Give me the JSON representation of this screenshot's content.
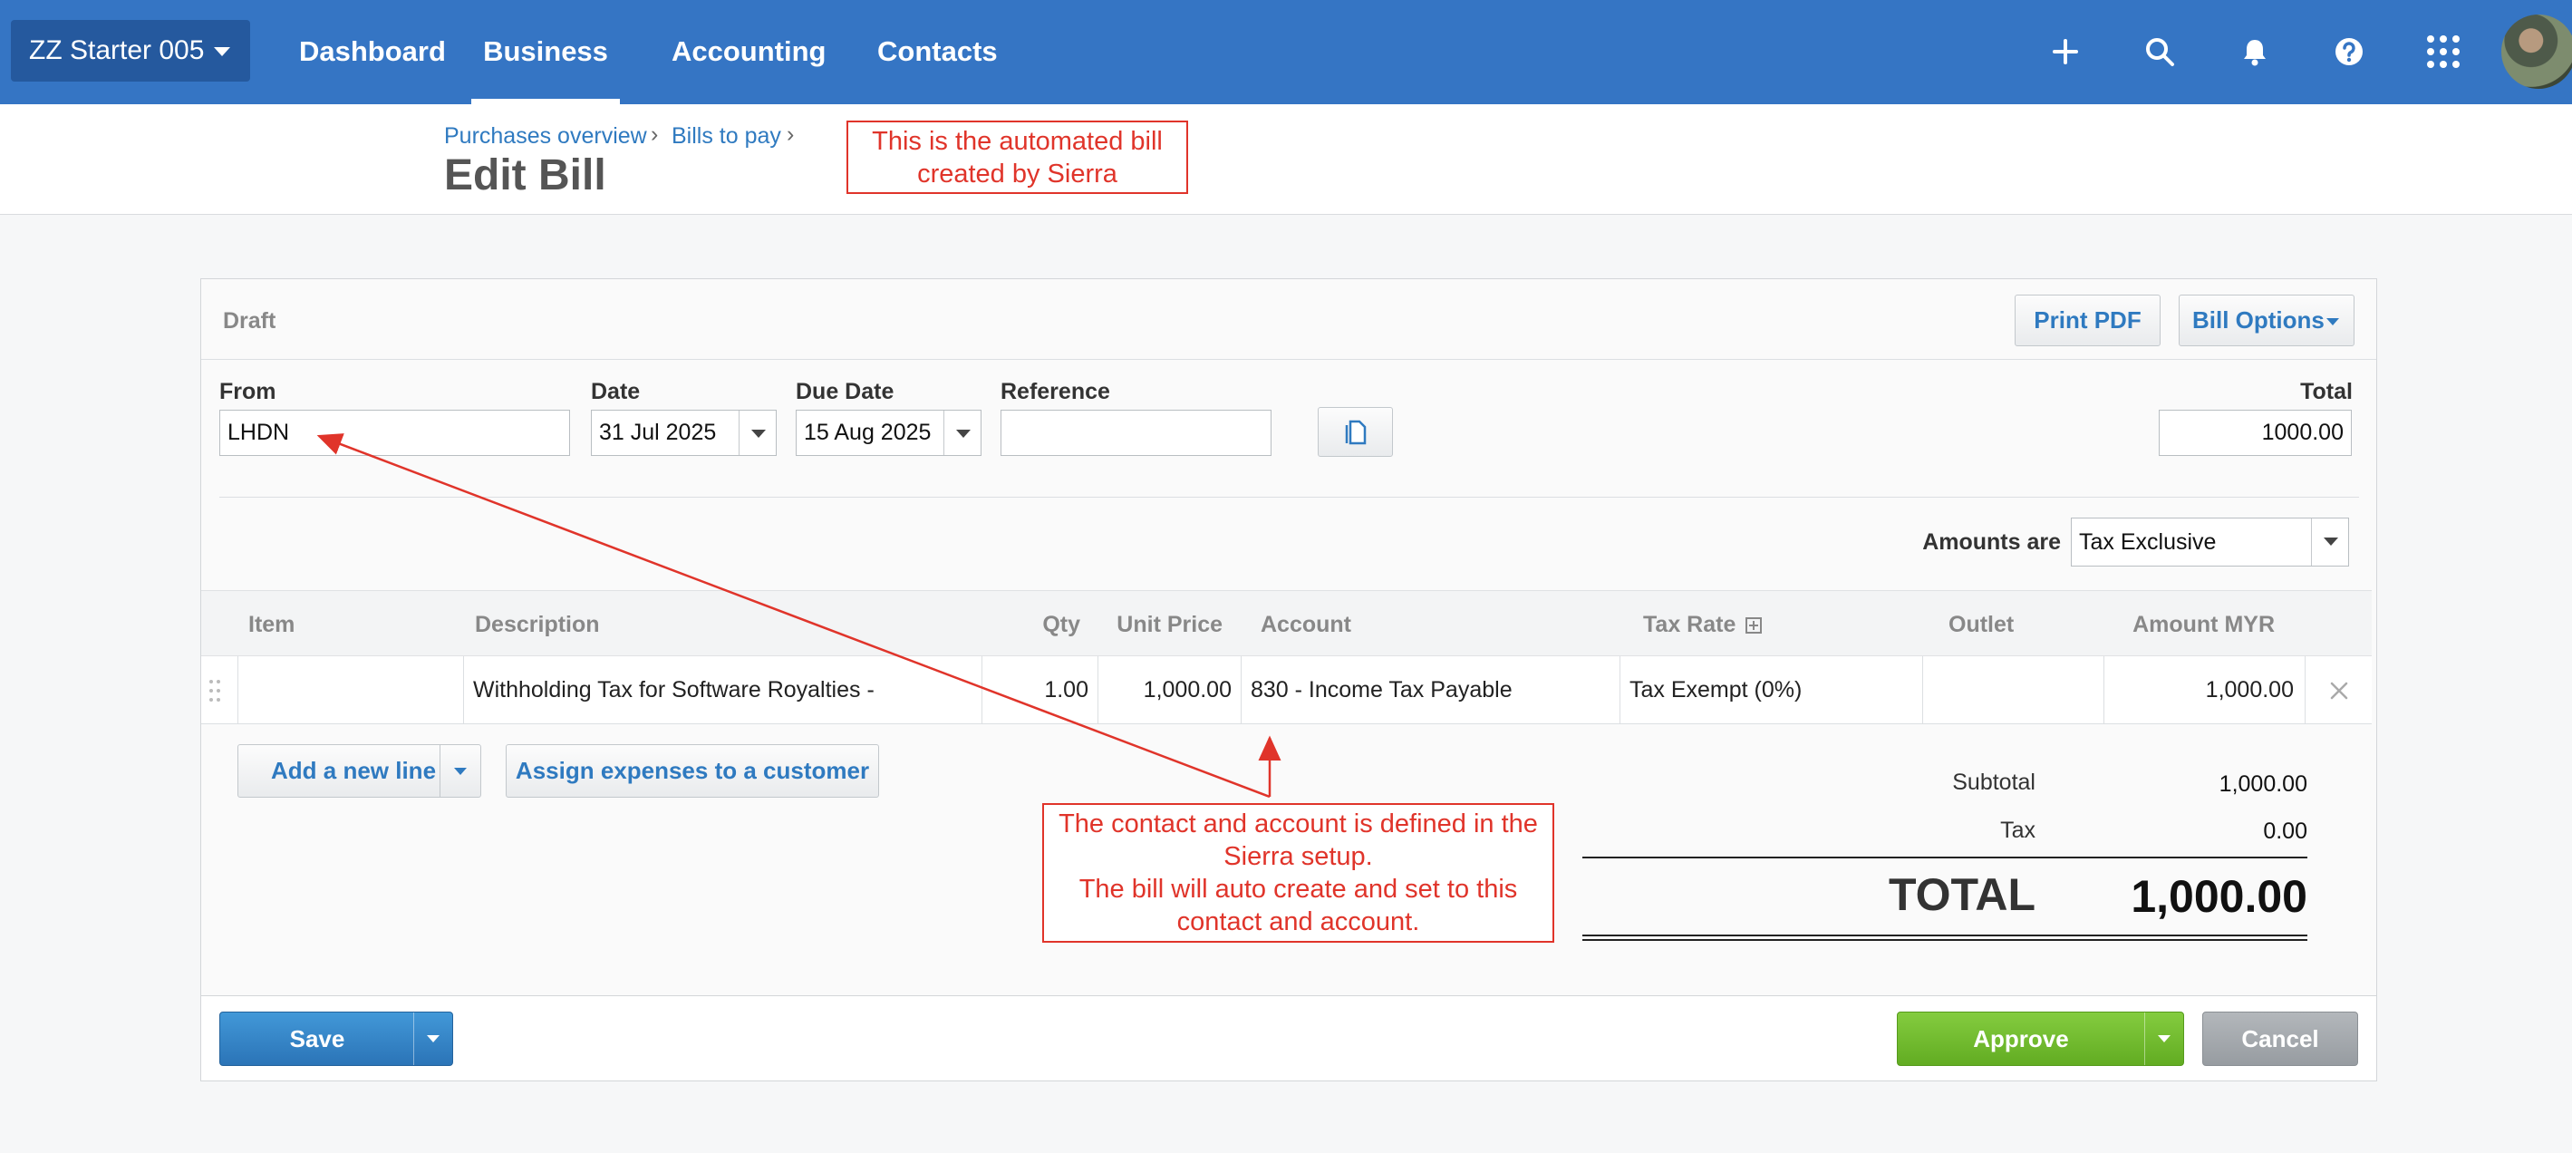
{
  "topnav": {
    "org_name": "ZZ Starter 005",
    "links": [
      "Dashboard",
      "Business",
      "Accounting",
      "Contacts"
    ],
    "active": "Business",
    "icons": [
      "plus-icon",
      "search-icon",
      "bell-icon",
      "help-icon",
      "apps-grid-icon",
      "avatar"
    ]
  },
  "breadcrumb": {
    "items": [
      "Purchases overview",
      "Bills to pay"
    ],
    "separator": "›"
  },
  "page": {
    "title": "Edit Bill"
  },
  "annotations": {
    "top_note": [
      "This is the automated bill",
      "created by Sierra"
    ],
    "middle_note": [
      "The contact and account is defined in the",
      "Sierra setup.",
      "The bill will auto create and set to this",
      "contact and account."
    ],
    "color": "#e0342a"
  },
  "bill": {
    "status": "Draft",
    "buttons": {
      "print_pdf": "Print PDF",
      "bill_options": "Bill Options"
    },
    "fields": {
      "from_label": "From",
      "from_value": "LHDN",
      "date_label": "Date",
      "date_value": "31 Jul 2025",
      "due_label": "Due Date",
      "due_value": "15 Aug 2025",
      "reference_label": "Reference",
      "reference_value": "",
      "total_label": "Total",
      "total_value": "1000.00"
    },
    "amounts_are_label": "Amounts are",
    "amounts_are_value": "Tax Exclusive",
    "columns": [
      "Item",
      "Description",
      "Qty",
      "Unit Price",
      "Account",
      "Tax Rate",
      "Outlet",
      "Amount MYR"
    ],
    "rows": [
      {
        "item": "",
        "description": "Withholding Tax for Software Royalties -",
        "qty": "1.00",
        "unit_price": "1,000.00",
        "account": "830 - Income Tax Payable",
        "tax_rate": "Tax Exempt (0%)",
        "outlet": "",
        "amount": "1,000.00"
      }
    ],
    "add_line_label": "Add a new line",
    "assign_label": "Assign expenses to a customer",
    "summary": {
      "subtotal_label": "Subtotal",
      "subtotal_value": "1,000.00",
      "tax_label": "Tax",
      "tax_value": "0.00",
      "total_label": "TOTAL",
      "total_value": "1,000.00"
    },
    "footer": {
      "save": "Save",
      "approve": "Approve",
      "cancel": "Cancel"
    }
  },
  "colors": {
    "nav_bg": "#3575c4",
    "org_bg": "#25599e",
    "link": "#2f7ac0",
    "save": "#2b74b7",
    "approve": "#62ac22",
    "cancel": "#979ca1"
  }
}
